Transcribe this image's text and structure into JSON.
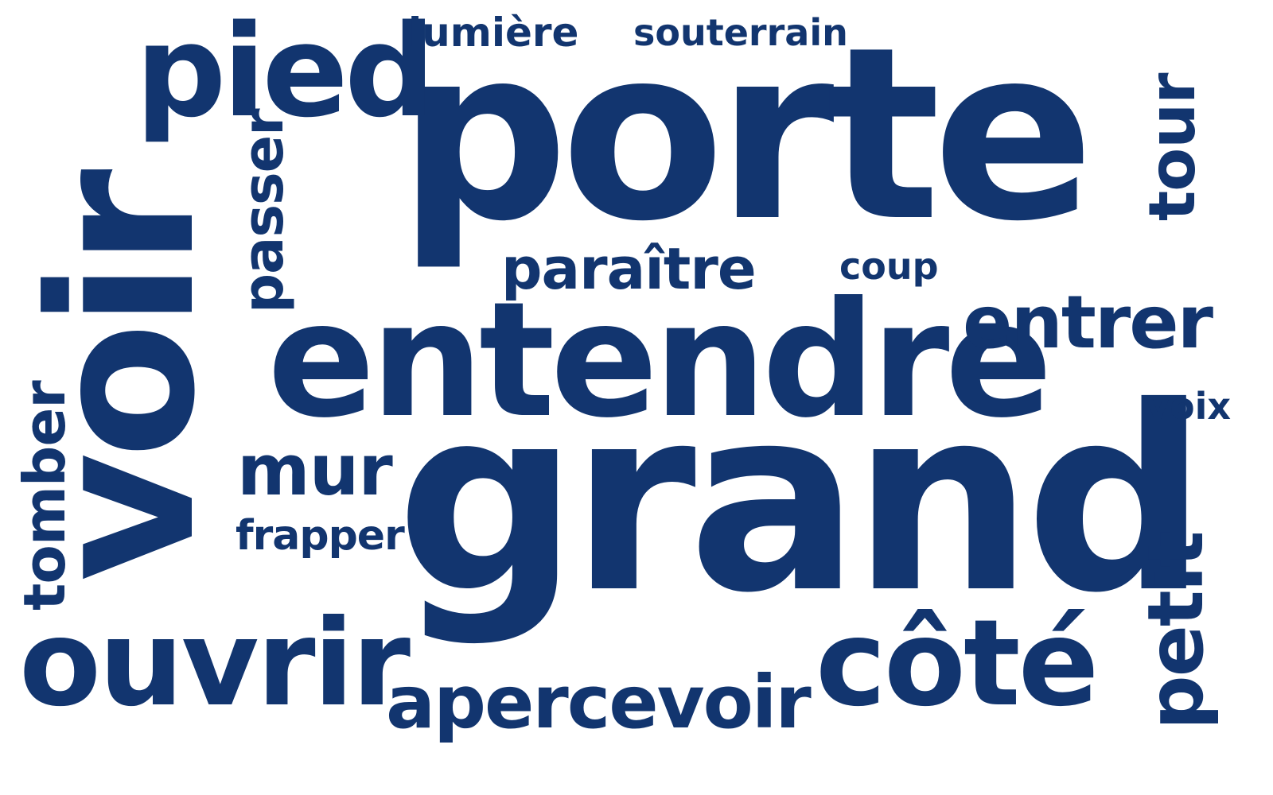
{
  "color": "#12356f",
  "words": {
    "porte": "porte",
    "grand": "grand",
    "voir": "voir",
    "entendre": "entendre",
    "ouvrir": "ouvrir",
    "cote": "côté",
    "pied": "pied",
    "apercevoir": "apercevoir",
    "entrer": "entrer",
    "paraitre": "paraître",
    "mur": "mur",
    "frapper": "frapper",
    "lumiere": "lumière",
    "souterrain": "souterrain",
    "coup": "coup",
    "voix": "voix",
    "passer": "passer",
    "tomber": "tomber",
    "tour": "tour",
    "petit": "petit"
  }
}
